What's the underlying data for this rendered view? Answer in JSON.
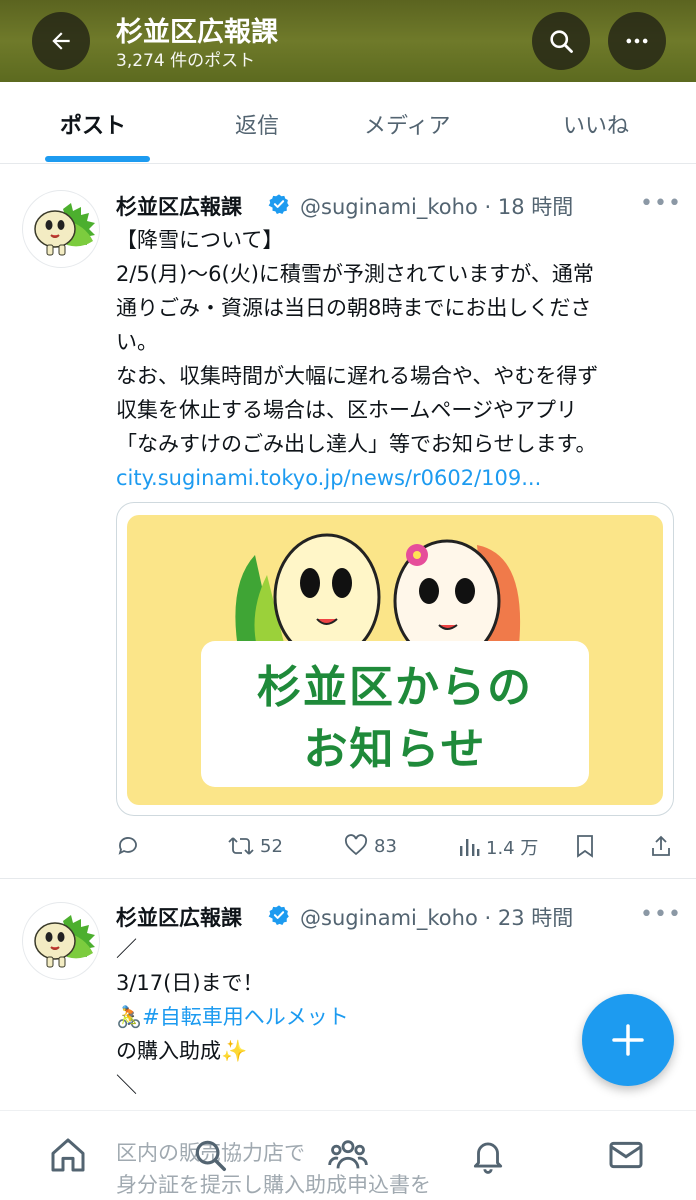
{
  "header": {
    "title": "杉並区広報課",
    "subtitle": "3,274 件のポスト"
  },
  "tabs": [
    {
      "label": "ポスト",
      "active": true
    },
    {
      "label": "返信",
      "active": false
    },
    {
      "label": "メディア",
      "active": false
    },
    {
      "label": "いいね",
      "active": false
    }
  ],
  "posts": [
    {
      "name": "杉並区広報課",
      "handle": "@suginami_koho",
      "time": "· 18 時間",
      "more": "•••",
      "lines": [
        "【降雪について】",
        "2/5(月)〜6(火)に積雪が予測されていますが、通常",
        "通りごみ・資源は当日の朝8時までにお出しくださ",
        "い。",
        "なお、収集時間が大幅に遅れる場合や、やむを得ず",
        "収集を休止する場合は、区ホームページやアプリ",
        "「なみすけのごみ出し達人」等でお知らせします。"
      ],
      "link": "city.suginami.tokyo.jp/news/r0602/109...",
      "card": {
        "line1": "杉並区からの",
        "line2": "お知らせ"
      },
      "actions": {
        "reply": "",
        "retweets": "52",
        "likes": "83",
        "views": "1.4 万"
      }
    },
    {
      "name": "杉並区広報課",
      "handle": "@suginami_koho",
      "time": "· 23 時間",
      "more": "•••",
      "lines": [
        "／",
        "3/17(日)まで！"
      ],
      "hashtag_emoji": "🚴",
      "hashtag": "#自転車用ヘルメット",
      "line_after": "の購入助成",
      "sparkle": "✨",
      "line_close": "＼",
      "faded_lines": [
        "区内の販売協力店で",
        "身分証を提示し購入助成申込書を"
      ]
    }
  ],
  "colors": {
    "accent": "#1d9bf0",
    "header_bg": "#6f7a2a",
    "card_bg": "#fbe589",
    "card_text": "#1f8a3a"
  },
  "icons": {
    "back": "arrow-left-icon",
    "search": "search-icon",
    "more": "more-icon",
    "compose": "plus-icon",
    "nav": [
      "home-icon",
      "search-icon",
      "communities-icon",
      "bell-icon",
      "mail-icon"
    ]
  }
}
